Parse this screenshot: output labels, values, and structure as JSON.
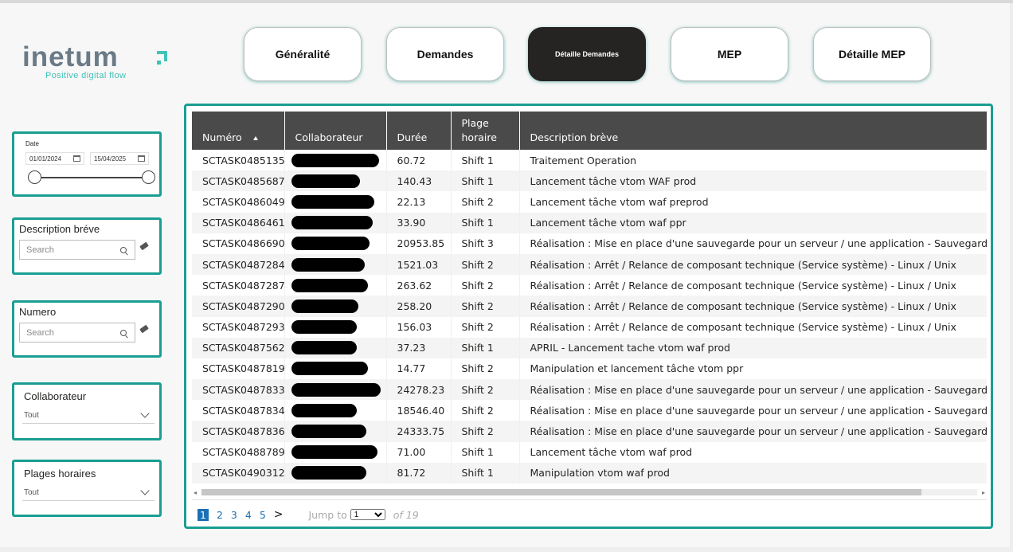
{
  "logo": {
    "word": "inetum",
    "tagline": "Positive digital flow",
    "accent": "#41c3b8"
  },
  "nav": [
    {
      "label": "Généralité",
      "active": false
    },
    {
      "label": "Demandes",
      "active": false
    },
    {
      "label": "Détaille Demandes",
      "active": true
    },
    {
      "label": "MEP",
      "active": false
    },
    {
      "label": "Détaille MEP",
      "active": false
    }
  ],
  "slicers": {
    "date": {
      "title": "Date",
      "start": "01/01/2024",
      "end": "15/04/2025"
    },
    "description": {
      "title": "Description bréve",
      "placeholder": "Search"
    },
    "numero": {
      "title": "Numero",
      "placeholder": "Search"
    },
    "collaborateur": {
      "title": "Collaborateur",
      "value": "Tout"
    },
    "plages": {
      "title": "Plages horaires",
      "value": "Tout"
    }
  },
  "table": {
    "columns": [
      "Numéro",
      "Collaborateur",
      "Durée",
      "Plage horaire",
      "Description brève"
    ],
    "rows": [
      {
        "numero": "SCTASK0485135",
        "duree": "60.72",
        "plage": "Shift 1",
        "desc": "Traitement Operation"
      },
      {
        "numero": "SCTASK0485687",
        "duree": "140.43",
        "plage": "Shift 1",
        "desc": "Lancement tâche vtom WAF prod"
      },
      {
        "numero": "SCTASK0486049",
        "duree": "22.13",
        "plage": "Shift 2",
        "desc": "Lancement tâche vtom waf preprod"
      },
      {
        "numero": "SCTASK0486461",
        "duree": "33.90",
        "plage": "Shift 1",
        "desc": "Lancement tâche vtom waf ppr"
      },
      {
        "numero": "SCTASK0486690",
        "duree": "20953.85",
        "plage": "Shift 3",
        "desc": "Réalisation : Mise en place d'une sauvegarde pour un serveur / une application - Sauvegarde et re"
      },
      {
        "numero": "SCTASK0487284",
        "duree": "1521.03",
        "plage": "Shift 2",
        "desc": "Réalisation : Arrêt / Relance de composant technique (Service système) - Linux / Unix"
      },
      {
        "numero": "SCTASK0487287",
        "duree": "263.62",
        "plage": "Shift 2",
        "desc": "Réalisation : Arrêt / Relance de composant technique (Service système) - Linux / Unix"
      },
      {
        "numero": "SCTASK0487290",
        "duree": "258.20",
        "plage": "Shift 2",
        "desc": "Réalisation : Arrêt / Relance de composant technique (Service système) - Linux / Unix"
      },
      {
        "numero": "SCTASK0487293",
        "duree": "156.03",
        "plage": "Shift 2",
        "desc": "Réalisation : Arrêt / Relance de composant technique (Service système) - Linux / Unix"
      },
      {
        "numero": "SCTASK0487562",
        "duree": "37.23",
        "plage": "Shift 1",
        "desc": "APRIL - Lancement tache vtom waf prod"
      },
      {
        "numero": "SCTASK0487819",
        "duree": "14.77",
        "plage": "Shift 2",
        "desc": "Manipulation et lancement tâche vtom ppr"
      },
      {
        "numero": "SCTASK0487833",
        "duree": "24278.23",
        "plage": "Shift 2",
        "desc": "Réalisation : Mise en place d'une sauvegarde pour un serveur / une application - Sauvegarde et re"
      },
      {
        "numero": "SCTASK0487834",
        "duree": "18546.40",
        "plage": "Shift 2",
        "desc": "Réalisation : Mise en place d'une sauvegarde pour un serveur / une application - Sauvegarde et re"
      },
      {
        "numero": "SCTASK0487836",
        "duree": "24333.75",
        "plage": "Shift 2",
        "desc": "Réalisation : Mise en place d'une sauvegarde pour un serveur / une application - Sauvegarde et re"
      },
      {
        "numero": "SCTASK0488789",
        "duree": "71.00",
        "plage": "Shift 1",
        "desc": "Lancement tâche vtom waf prod"
      },
      {
        "numero": "SCTASK0490312",
        "duree": "81.72",
        "plage": "Shift 1",
        "desc": "Manipulation vtom waf prod"
      }
    ]
  },
  "pager": {
    "pages": [
      "1",
      "2",
      "3",
      "4",
      "5"
    ],
    "current": "1",
    "next": ">",
    "jump_label": "Jump to",
    "jump_value": "1",
    "of_label": "of 19"
  }
}
